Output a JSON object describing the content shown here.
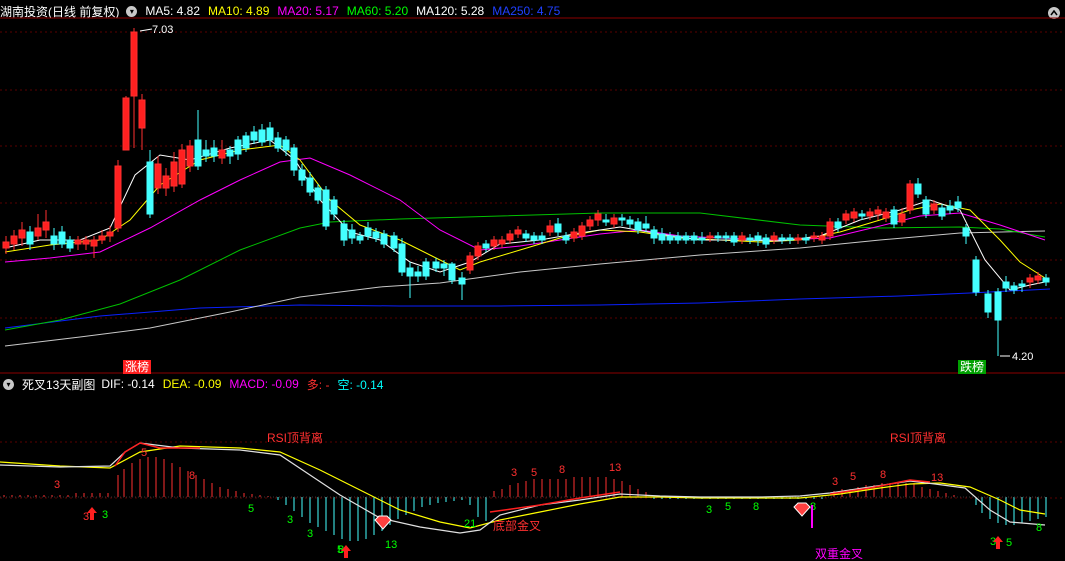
{
  "header": {
    "title": "湖南投资(日线 前复权)",
    "ma": [
      {
        "label": "MA5: 4.82",
        "color": "#ffffff"
      },
      {
        "label": "MA10: 4.89",
        "color": "#ffff00"
      },
      {
        "label": "MA20: 5.17",
        "color": "#ff00ff"
      },
      {
        "label": "MA60: 5.20",
        "color": "#00ff00"
      },
      {
        "label": "MA120: 5.28",
        "color": "#ffffff"
      },
      {
        "label": "MA250: 4.75",
        "color": "#0000ff"
      }
    ]
  },
  "price_chart": {
    "high_label": "7.03",
    "low_label": "4.20",
    "badge_left": "涨榜",
    "badge_right": "跌榜"
  },
  "indicator": {
    "title": "死叉13天副图",
    "items": [
      {
        "label": "DIF: -0.14",
        "color": "#ffffff"
      },
      {
        "label": "DEA: -0.09",
        "color": "#ffff00"
      },
      {
        "label": "MACD: -0.09",
        "color": "#ff00ff"
      },
      {
        "label": "多: -",
        "color": "#ff0000"
      },
      {
        "label": "空: -0.14",
        "color": "#00ffff"
      }
    ],
    "rsi_label": "RSI顶背离",
    "bottom_gold_cross": "底部金叉",
    "double_gold_cross": "双重金叉",
    "count_labels": [
      {
        "t": "3",
        "c": "#ff3030"
      },
      {
        "t": "3",
        "c": "#ff3030"
      },
      {
        "t": "5",
        "c": "#ff3030"
      },
      {
        "t": "8",
        "c": "#ff3030"
      },
      {
        "t": "3",
        "c": "#00ff00"
      },
      {
        "t": "5",
        "c": "#00ff00"
      },
      {
        "t": "3",
        "c": "#00ff00"
      },
      {
        "t": "3",
        "c": "#00ff00"
      },
      {
        "t": "5",
        "c": "#00ff00"
      },
      {
        "t": "8",
        "c": "#00ff00"
      },
      {
        "t": "13",
        "c": "#00ff00"
      },
      {
        "t": "21",
        "c": "#00ff00"
      },
      {
        "t": "3",
        "c": "#ff3030"
      },
      {
        "t": "5",
        "c": "#ff3030"
      },
      {
        "t": "8",
        "c": "#ff3030"
      },
      {
        "t": "13",
        "c": "#ff3030"
      },
      {
        "t": "3",
        "c": "#00ff00"
      },
      {
        "t": "5",
        "c": "#00ff00"
      },
      {
        "t": "8",
        "c": "#00ff00"
      },
      {
        "t": "8",
        "c": "#00ff00"
      },
      {
        "t": "3",
        "c": "#ff3030"
      },
      {
        "t": "5",
        "c": "#ff3030"
      },
      {
        "t": "8",
        "c": "#ff3030"
      },
      {
        "t": "13",
        "c": "#ff3030"
      },
      {
        "t": "3",
        "c": "#00ff00"
      },
      {
        "t": "5",
        "c": "#00ff00"
      },
      {
        "t": "8",
        "c": "#00ff00"
      }
    ]
  }
}
